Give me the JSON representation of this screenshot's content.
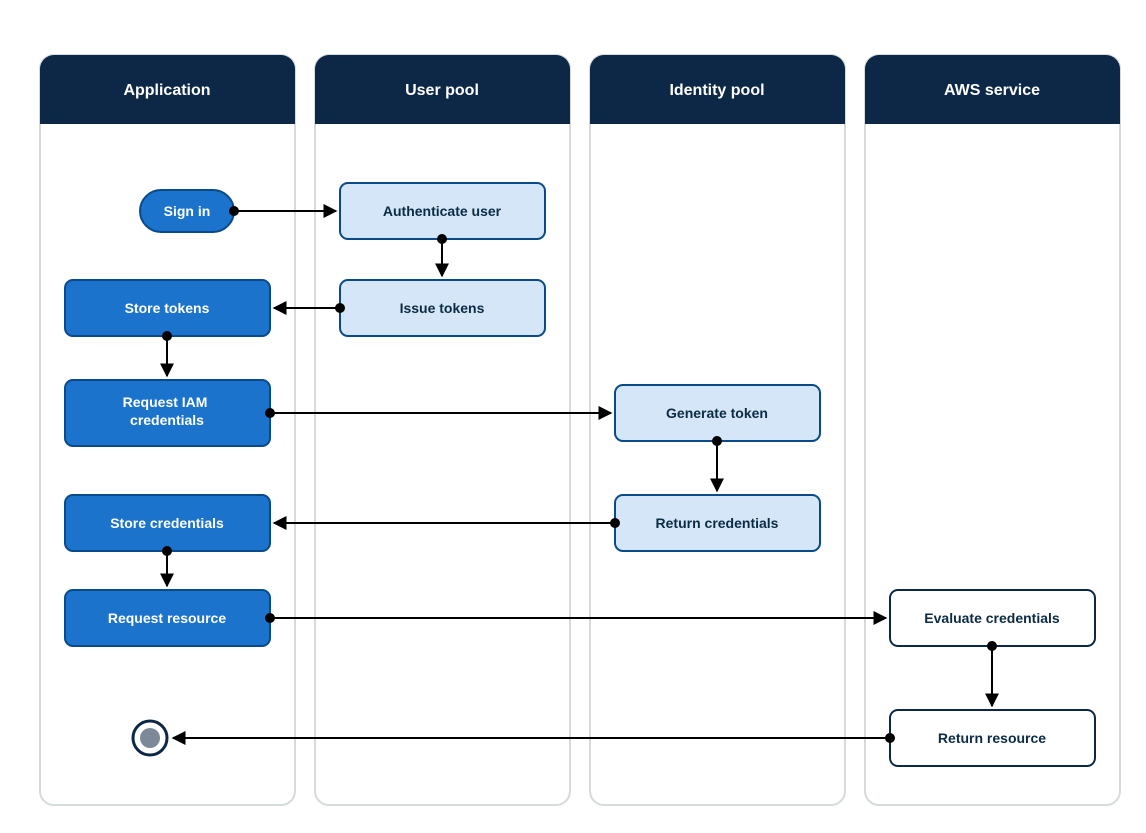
{
  "diagram": {
    "lanes": {
      "application": "Application",
      "user_pool": "User pool",
      "identity_pool": "Identity pool",
      "aws_service": "AWS service"
    },
    "nodes": {
      "sign_in": "Sign in",
      "authenticate_user": "Authenticate user",
      "issue_tokens": "Issue tokens",
      "store_tokens": "Store tokens",
      "request_iam_line1": "Request IAM",
      "request_iam_line2": "credentials",
      "generate_token": "Generate token",
      "return_credentials": "Return credentials",
      "store_credentials": "Store credentials",
      "request_resource": "Request resource",
      "evaluate_credentials": "Evaluate credentials",
      "return_resource": "Return resource"
    },
    "colors": {
      "header_bg": "#0d2847",
      "lane_border": "#d5dbdb",
      "blue_fill": "#1b73cc",
      "blue_stroke": "#0a4a8a",
      "light_fill": "#d4e6f7",
      "light_stroke": "#0a4a8a",
      "white_fill": "#ffffff",
      "white_stroke": "#0d2847",
      "arrow": "#000000",
      "end_inner": "#7d8998",
      "end_outer": "#0d2847"
    }
  }
}
